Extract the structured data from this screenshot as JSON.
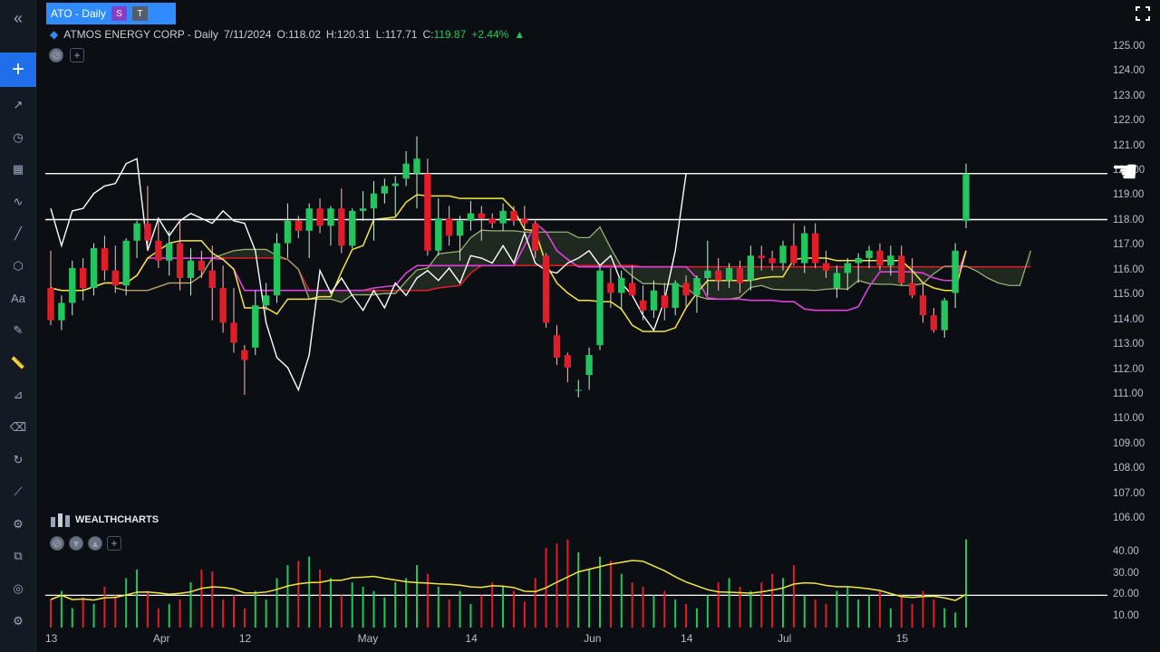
{
  "symbol_bar": {
    "ticker": "ATO - Daily",
    "badge_s": "S",
    "badge_t": "T"
  },
  "legend": {
    "name": "ATMOS ENERGY CORP - Daily",
    "date": "7/11/2024",
    "open_label": "O:",
    "open": "118.02",
    "high_label": "H:",
    "high": "120.31",
    "low_label": "L:",
    "low": "117.71",
    "close_label": "C:",
    "close": "119.87",
    "change": "+2.44%"
  },
  "watermark": "WEALTHCHARTS",
  "price_axis": [
    "125.00",
    "124.00",
    "123.00",
    "122.00",
    "121.00",
    "120.00",
    "119.00",
    "118.00",
    "117.00",
    "116.00",
    "115.00",
    "114.00",
    "113.00",
    "112.00",
    "111.00",
    "110.00",
    "109.00",
    "108.00",
    "107.00",
    "106.00"
  ],
  "volume_axis": [
    "40.00",
    "30.00",
    "20.00",
    "10.00"
  ],
  "time_axis": [
    "13",
    "Apr",
    "12",
    "May",
    "14",
    "Jun",
    "14",
    "Jul",
    "15"
  ],
  "colors": {
    "up": "#22c55e",
    "down": "#e11d2a",
    "accent": "#2f8bff",
    "tenkan": "#f5e63a",
    "kijun": "#e040e0",
    "lagging": "#ffffff",
    "level": "#ffffff"
  },
  "left_toolbar": [
    "collapse-icon",
    "add-icon",
    "trend-icon",
    "clock-icon",
    "calendar-icon",
    "wave-icon",
    "line-icon",
    "shapes-icon",
    "text-icon",
    "pencil-icon",
    "ruler-icon",
    "measure-icon",
    "eraser-icon",
    "refresh-icon",
    "chart-icon",
    "indicator-icon",
    "copy-icon",
    "compass-icon",
    "settings-icon"
  ],
  "chart_data": {
    "type": "candlestick",
    "title": "ATMOS ENERGY CORP - Daily",
    "horizontal_levels": [
      119.9,
      118.05
    ],
    "ylim": [
      105.5,
      125.5
    ],
    "candles": [
      [
        115.3,
        116.8,
        113.8,
        114.0
      ],
      [
        114.0,
        115.0,
        113.6,
        114.7
      ],
      [
        114.7,
        116.4,
        114.2,
        116.1
      ],
      [
        116.1,
        116.5,
        114.8,
        115.3
      ],
      [
        115.3,
        117.1,
        115.0,
        116.9
      ],
      [
        116.9,
        117.4,
        115.6,
        116.0
      ],
      [
        116.0,
        117.0,
        115.1,
        115.4
      ],
      [
        115.4,
        117.3,
        115.0,
        117.2
      ],
      [
        117.2,
        118.0,
        116.5,
        117.9
      ],
      [
        117.9,
        119.4,
        116.8,
        117.2
      ],
      [
        117.2,
        118.0,
        116.1,
        116.4
      ],
      [
        116.4,
        117.6,
        115.8,
        117.1
      ],
      [
        117.1,
        118.0,
        115.2,
        115.7
      ],
      [
        115.7,
        116.9,
        115.0,
        116.4
      ],
      [
        116.4,
        116.8,
        115.7,
        116.0
      ],
      [
        116.0,
        117.0,
        114.0,
        115.3
      ],
      [
        115.3,
        116.2,
        113.5,
        113.9
      ],
      [
        113.9,
        115.3,
        112.7,
        113.1
      ],
      [
        112.8,
        113.0,
        111.0,
        112.4
      ],
      [
        112.9,
        115.2,
        112.6,
        114.6
      ],
      [
        114.6,
        115.5,
        114.4,
        115.0
      ],
      [
        115.0,
        117.5,
        114.7,
        117.1
      ],
      [
        117.1,
        118.7,
        116.5,
        118.0
      ],
      [
        118.0,
        118.2,
        117.3,
        117.6
      ],
      [
        117.6,
        118.7,
        116.5,
        118.5
      ],
      [
        118.5,
        118.9,
        117.5,
        117.8
      ],
      [
        117.8,
        118.6,
        117.0,
        118.5
      ],
      [
        118.5,
        119.3,
        116.7,
        117.0
      ],
      [
        117.0,
        118.5,
        116.9,
        118.4
      ],
      [
        118.4,
        119.2,
        118.0,
        118.5
      ],
      [
        118.5,
        119.6,
        117.2,
        119.1
      ],
      [
        119.1,
        119.7,
        118.7,
        119.4
      ],
      [
        119.4,
        119.8,
        118.2,
        119.5
      ],
      [
        119.7,
        120.8,
        119.4,
        120.3
      ],
      [
        119.9,
        121.4,
        118.5,
        120.5
      ],
      [
        119.9,
        120.5,
        116.6,
        116.8
      ],
      [
        116.8,
        118.9,
        116.6,
        118.1
      ],
      [
        118.1,
        118.6,
        117.0,
        117.4
      ],
      [
        117.4,
        118.2,
        116.4,
        118.0
      ],
      [
        118.0,
        118.8,
        117.6,
        118.3
      ],
      [
        118.3,
        118.6,
        117.2,
        118.1
      ],
      [
        118.1,
        118.3,
        117.7,
        117.9
      ],
      [
        117.9,
        118.7,
        117.6,
        118.4
      ],
      [
        118.4,
        118.6,
        117.8,
        118.0
      ],
      [
        118.1,
        118.6,
        117.6,
        117.9
      ],
      [
        117.9,
        118.0,
        116.5,
        116.8
      ],
      [
        116.6,
        116.7,
        113.7,
        113.9
      ],
      [
        113.4,
        113.8,
        112.2,
        112.5
      ],
      [
        112.6,
        112.7,
        111.5,
        112.1
      ],
      [
        111.2,
        111.6,
        110.9,
        111.2
      ],
      [
        111.8,
        112.9,
        111.2,
        112.6
      ],
      [
        113.0,
        116.2,
        112.8,
        116.0
      ],
      [
        115.5,
        116.1,
        114.5,
        115.1
      ],
      [
        115.1,
        116.0,
        114.4,
        115.7
      ],
      [
        115.5,
        116.2,
        115.0,
        115.0
      ],
      [
        114.8,
        115.4,
        114.0,
        114.4
      ],
      [
        114.4,
        115.6,
        114.1,
        115.2
      ],
      [
        115.0,
        115.5,
        114.0,
        114.5
      ],
      [
        114.5,
        115.6,
        114.2,
        115.5
      ],
      [
        115.5,
        115.8,
        114.5,
        115.0
      ],
      [
        115.0,
        115.8,
        114.3,
        115.7
      ],
      [
        115.7,
        117.2,
        115.0,
        116.0
      ],
      [
        116.0,
        116.5,
        115.2,
        115.6
      ],
      [
        115.6,
        116.3,
        115.3,
        116.1
      ],
      [
        116.1,
        116.4,
        115.1,
        115.5
      ],
      [
        115.6,
        117.0,
        115.2,
        116.6
      ],
      [
        116.6,
        117.0,
        116.0,
        116.5
      ],
      [
        116.5,
        116.8,
        116.0,
        116.3
      ],
      [
        116.3,
        117.2,
        116.0,
        117.0
      ],
      [
        117.0,
        117.9,
        116.2,
        116.3
      ],
      [
        116.3,
        117.8,
        115.9,
        117.5
      ],
      [
        117.5,
        117.9,
        116.1,
        116.3
      ],
      [
        116.3,
        116.8,
        115.7,
        116.0
      ],
      [
        115.3,
        116.2,
        114.9,
        115.9
      ],
      [
        115.9,
        116.5,
        115.2,
        116.3
      ],
      [
        116.3,
        116.7,
        115.5,
        116.5
      ],
      [
        116.5,
        117.0,
        116.1,
        116.8
      ],
      [
        116.8,
        117.1,
        116.0,
        116.2
      ],
      [
        116.2,
        117.0,
        115.8,
        116.6
      ],
      [
        116.6,
        117.0,
        115.4,
        115.5
      ],
      [
        115.5,
        116.5,
        114.9,
        115.0
      ],
      [
        115.0,
        115.5,
        113.9,
        114.2
      ],
      [
        114.2,
        114.5,
        113.5,
        113.6
      ],
      [
        113.6,
        114.9,
        113.3,
        114.8
      ],
      [
        115.1,
        117.1,
        114.5,
        116.8
      ],
      [
        118.0,
        120.3,
        117.7,
        119.9
      ]
    ],
    "volume": [
      18,
      22,
      14,
      19,
      16,
      24,
      20,
      28,
      32,
      22,
      14,
      16,
      18,
      26,
      32,
      31,
      18,
      20,
      14,
      22,
      18,
      28,
      34,
      36,
      38,
      32,
      28,
      20,
      26,
      24,
      22,
      19,
      26,
      28,
      34,
      30,
      24,
      18,
      22,
      16,
      20,
      26,
      24,
      22,
      17,
      28,
      42,
      44,
      46,
      40,
      32,
      38,
      36,
      30,
      26,
      24,
      20,
      22,
      18,
      16,
      14,
      20,
      26,
      28,
      24,
      22,
      26,
      30,
      28,
      34,
      20,
      18,
      16,
      22,
      24,
      18,
      20,
      22,
      14,
      20,
      16,
      22,
      18,
      14,
      12,
      46
    ],
    "volume_ylim": [
      5,
      45
    ],
    "x_ticks": [
      "13",
      "Apr",
      "12",
      "May",
      "14",
      "Jun",
      "14",
      "Jul",
      "15"
    ]
  }
}
